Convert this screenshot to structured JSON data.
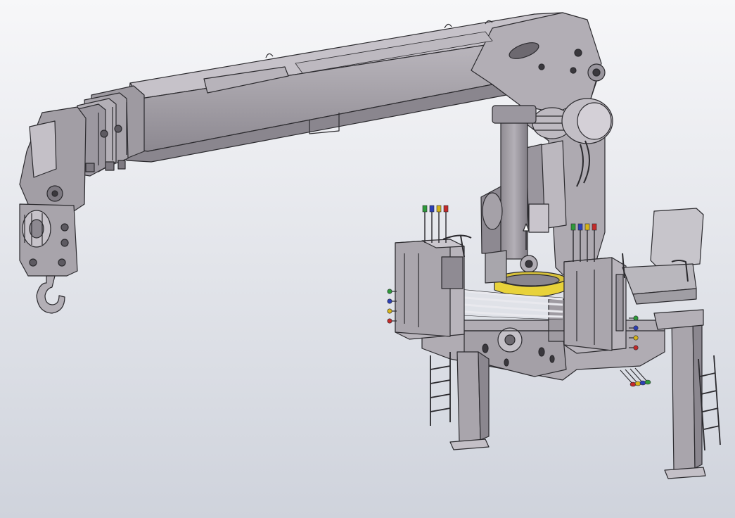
{
  "scene": {
    "subject": "truck-mounted-knuckle-boom-crane-cad-model",
    "background": {
      "top": "#f7f7f9",
      "bottom": "#cfd3dc"
    },
    "colors": {
      "body": "#aaa6ac",
      "body_dark": "#8e8a91",
      "body_light": "#c8c4ca",
      "outline": "#2b2a2e",
      "slew_ring": "#e8d23a",
      "seat": "#c2c0c6",
      "cable": "#e9e9ee"
    },
    "lever_knobs": [
      "#2e9a3a",
      "#2c3fb6",
      "#d6b418",
      "#c42a2a"
    ]
  }
}
